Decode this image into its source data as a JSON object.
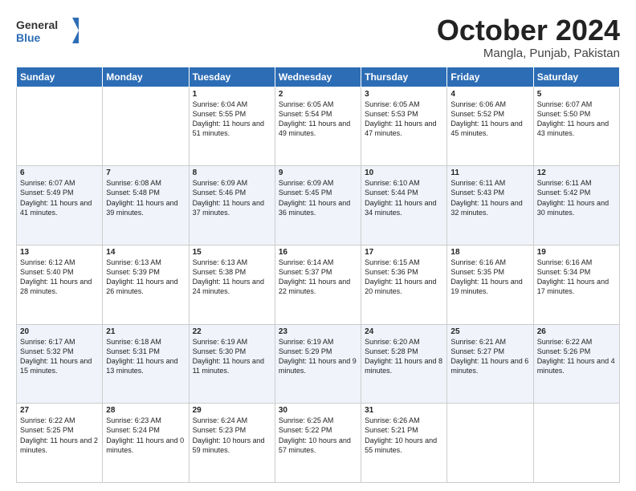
{
  "header": {
    "logo_general": "General",
    "logo_blue": "Blue",
    "month": "October 2024",
    "location": "Mangla, Punjab, Pakistan"
  },
  "weekdays": [
    "Sunday",
    "Monday",
    "Tuesday",
    "Wednesday",
    "Thursday",
    "Friday",
    "Saturday"
  ],
  "weeks": [
    [
      {
        "day": "",
        "sunrise": "",
        "sunset": "",
        "daylight": ""
      },
      {
        "day": "",
        "sunrise": "",
        "sunset": "",
        "daylight": ""
      },
      {
        "day": "1",
        "sunrise": "Sunrise: 6:04 AM",
        "sunset": "Sunset: 5:55 PM",
        "daylight": "Daylight: 11 hours and 51 minutes."
      },
      {
        "day": "2",
        "sunrise": "Sunrise: 6:05 AM",
        "sunset": "Sunset: 5:54 PM",
        "daylight": "Daylight: 11 hours and 49 minutes."
      },
      {
        "day": "3",
        "sunrise": "Sunrise: 6:05 AM",
        "sunset": "Sunset: 5:53 PM",
        "daylight": "Daylight: 11 hours and 47 minutes."
      },
      {
        "day": "4",
        "sunrise": "Sunrise: 6:06 AM",
        "sunset": "Sunset: 5:52 PM",
        "daylight": "Daylight: 11 hours and 45 minutes."
      },
      {
        "day": "5",
        "sunrise": "Sunrise: 6:07 AM",
        "sunset": "Sunset: 5:50 PM",
        "daylight": "Daylight: 11 hours and 43 minutes."
      }
    ],
    [
      {
        "day": "6",
        "sunrise": "Sunrise: 6:07 AM",
        "sunset": "Sunset: 5:49 PM",
        "daylight": "Daylight: 11 hours and 41 minutes."
      },
      {
        "day": "7",
        "sunrise": "Sunrise: 6:08 AM",
        "sunset": "Sunset: 5:48 PM",
        "daylight": "Daylight: 11 hours and 39 minutes."
      },
      {
        "day": "8",
        "sunrise": "Sunrise: 6:09 AM",
        "sunset": "Sunset: 5:46 PM",
        "daylight": "Daylight: 11 hours and 37 minutes."
      },
      {
        "day": "9",
        "sunrise": "Sunrise: 6:09 AM",
        "sunset": "Sunset: 5:45 PM",
        "daylight": "Daylight: 11 hours and 36 minutes."
      },
      {
        "day": "10",
        "sunrise": "Sunrise: 6:10 AM",
        "sunset": "Sunset: 5:44 PM",
        "daylight": "Daylight: 11 hours and 34 minutes."
      },
      {
        "day": "11",
        "sunrise": "Sunrise: 6:11 AM",
        "sunset": "Sunset: 5:43 PM",
        "daylight": "Daylight: 11 hours and 32 minutes."
      },
      {
        "day": "12",
        "sunrise": "Sunrise: 6:11 AM",
        "sunset": "Sunset: 5:42 PM",
        "daylight": "Daylight: 11 hours and 30 minutes."
      }
    ],
    [
      {
        "day": "13",
        "sunrise": "Sunrise: 6:12 AM",
        "sunset": "Sunset: 5:40 PM",
        "daylight": "Daylight: 11 hours and 28 minutes."
      },
      {
        "day": "14",
        "sunrise": "Sunrise: 6:13 AM",
        "sunset": "Sunset: 5:39 PM",
        "daylight": "Daylight: 11 hours and 26 minutes."
      },
      {
        "day": "15",
        "sunrise": "Sunrise: 6:13 AM",
        "sunset": "Sunset: 5:38 PM",
        "daylight": "Daylight: 11 hours and 24 minutes."
      },
      {
        "day": "16",
        "sunrise": "Sunrise: 6:14 AM",
        "sunset": "Sunset: 5:37 PM",
        "daylight": "Daylight: 11 hours and 22 minutes."
      },
      {
        "day": "17",
        "sunrise": "Sunrise: 6:15 AM",
        "sunset": "Sunset: 5:36 PM",
        "daylight": "Daylight: 11 hours and 20 minutes."
      },
      {
        "day": "18",
        "sunrise": "Sunrise: 6:16 AM",
        "sunset": "Sunset: 5:35 PM",
        "daylight": "Daylight: 11 hours and 19 minutes."
      },
      {
        "day": "19",
        "sunrise": "Sunrise: 6:16 AM",
        "sunset": "Sunset: 5:34 PM",
        "daylight": "Daylight: 11 hours and 17 minutes."
      }
    ],
    [
      {
        "day": "20",
        "sunrise": "Sunrise: 6:17 AM",
        "sunset": "Sunset: 5:32 PM",
        "daylight": "Daylight: 11 hours and 15 minutes."
      },
      {
        "day": "21",
        "sunrise": "Sunrise: 6:18 AM",
        "sunset": "Sunset: 5:31 PM",
        "daylight": "Daylight: 11 hours and 13 minutes."
      },
      {
        "day": "22",
        "sunrise": "Sunrise: 6:19 AM",
        "sunset": "Sunset: 5:30 PM",
        "daylight": "Daylight: 11 hours and 11 minutes."
      },
      {
        "day": "23",
        "sunrise": "Sunrise: 6:19 AM",
        "sunset": "Sunset: 5:29 PM",
        "daylight": "Daylight: 11 hours and 9 minutes."
      },
      {
        "day": "24",
        "sunrise": "Sunrise: 6:20 AM",
        "sunset": "Sunset: 5:28 PM",
        "daylight": "Daylight: 11 hours and 8 minutes."
      },
      {
        "day": "25",
        "sunrise": "Sunrise: 6:21 AM",
        "sunset": "Sunset: 5:27 PM",
        "daylight": "Daylight: 11 hours and 6 minutes."
      },
      {
        "day": "26",
        "sunrise": "Sunrise: 6:22 AM",
        "sunset": "Sunset: 5:26 PM",
        "daylight": "Daylight: 11 hours and 4 minutes."
      }
    ],
    [
      {
        "day": "27",
        "sunrise": "Sunrise: 6:22 AM",
        "sunset": "Sunset: 5:25 PM",
        "daylight": "Daylight: 11 hours and 2 minutes."
      },
      {
        "day": "28",
        "sunrise": "Sunrise: 6:23 AM",
        "sunset": "Sunset: 5:24 PM",
        "daylight": "Daylight: 11 hours and 0 minutes."
      },
      {
        "day": "29",
        "sunrise": "Sunrise: 6:24 AM",
        "sunset": "Sunset: 5:23 PM",
        "daylight": "Daylight: 10 hours and 59 minutes."
      },
      {
        "day": "30",
        "sunrise": "Sunrise: 6:25 AM",
        "sunset": "Sunset: 5:22 PM",
        "daylight": "Daylight: 10 hours and 57 minutes."
      },
      {
        "day": "31",
        "sunrise": "Sunrise: 6:26 AM",
        "sunset": "Sunset: 5:21 PM",
        "daylight": "Daylight: 10 hours and 55 minutes."
      },
      {
        "day": "",
        "sunrise": "",
        "sunset": "",
        "daylight": ""
      },
      {
        "day": "",
        "sunrise": "",
        "sunset": "",
        "daylight": ""
      }
    ]
  ]
}
